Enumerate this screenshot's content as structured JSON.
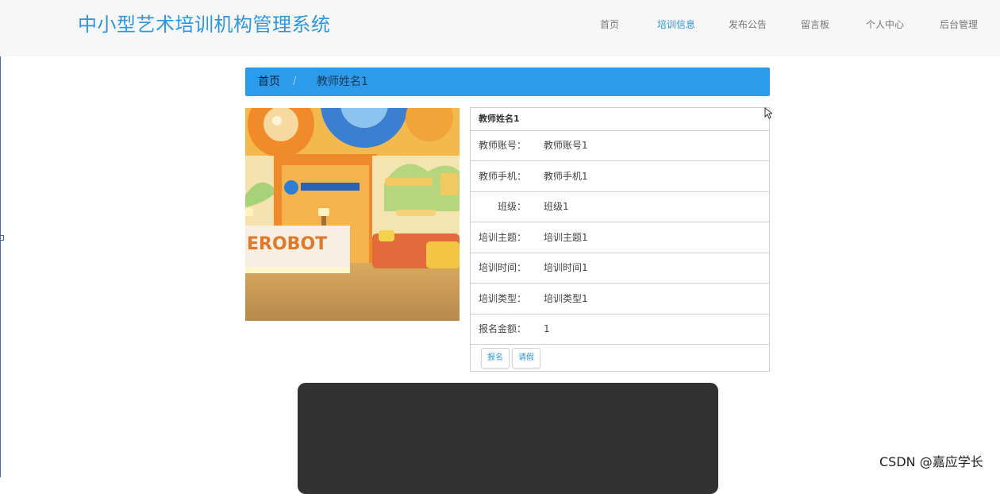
{
  "app": {
    "title": "中小型艺术培训机构管理系统"
  },
  "nav": {
    "items": [
      {
        "label": "首页",
        "active": false
      },
      {
        "label": "培训信息",
        "active": true
      },
      {
        "label": "发布公告",
        "active": false
      },
      {
        "label": "留言板",
        "active": false
      },
      {
        "label": "个人中心",
        "active": false
      },
      {
        "label": "后台管理",
        "active": false
      }
    ]
  },
  "breadcrumb": {
    "home": "首页",
    "separator": "/",
    "current": "教师姓名1"
  },
  "detail": {
    "heading": "教师姓名1",
    "rows": [
      {
        "label": "教师账号：",
        "value": "教师账号1"
      },
      {
        "label": "教师手机：",
        "value": "教师手机1"
      },
      {
        "label": "班级：",
        "value": "班级1"
      },
      {
        "label": "培训主题：",
        "value": "培训主题1"
      },
      {
        "label": "培训时间：",
        "value": "培训时间1"
      },
      {
        "label": "培训类型：",
        "value": "培训类型1"
      },
      {
        "label": "报名金额：",
        "value": "1"
      }
    ],
    "buttons": {
      "signup": "报名",
      "leave": "请假"
    }
  },
  "photo": {
    "sign_text": "EROBOT"
  },
  "watermark": "CSDN @嘉应学长",
  "colors": {
    "accent": "#2d96e0",
    "breadcrumb_bg": "#2d9bec",
    "video_bg": "#323232"
  }
}
